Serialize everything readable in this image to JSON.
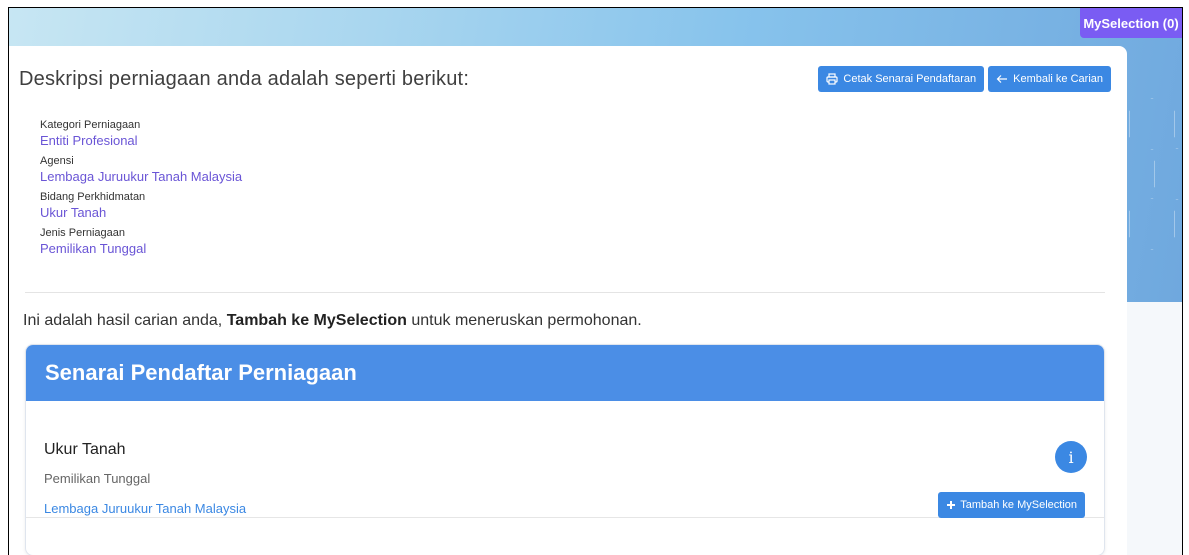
{
  "header": {
    "myselection_label": "MySelection (0)"
  },
  "page": {
    "title": "Deskripsi perniagaan anda adalah seperti berikut:",
    "print_button": "Cetak Senarai Pendaftaran",
    "back_button": "Kembali ke Carian"
  },
  "description": [
    {
      "label": "Kategori Perniagaan",
      "value": "Entiti Profesional"
    },
    {
      "label": "Agensi",
      "value": "Lembaga Juruukur Tanah Malaysia"
    },
    {
      "label": "Bidang Perkhidmatan",
      "value": "Ukur Tanah"
    },
    {
      "label": "Jenis Perniagaan",
      "value": "Pemilikan Tunggal"
    }
  ],
  "results": {
    "intro_before": "Ini adalah hasil carian anda, ",
    "intro_bold": "Tambah ke MySelection",
    "intro_after": " untuk meneruskan permohonan.",
    "list_title": "Senarai Pendaftar Perniagaan",
    "items": [
      {
        "title": "Ukur Tanah",
        "subtitle": "Pemilikan Tunggal",
        "agency": "Lembaga Juruukur Tanah Malaysia",
        "info_icon_glyph": "i",
        "add_button": "Tambah ke MySelection"
      }
    ]
  },
  "icons": {
    "print": "printer-icon",
    "back": "arrow-left-icon",
    "info": "info-icon",
    "add": "plus-icon"
  },
  "colors": {
    "accent": "#3b88e3",
    "myselection": "#7a5cf3",
    "link": "#6a55d6"
  }
}
